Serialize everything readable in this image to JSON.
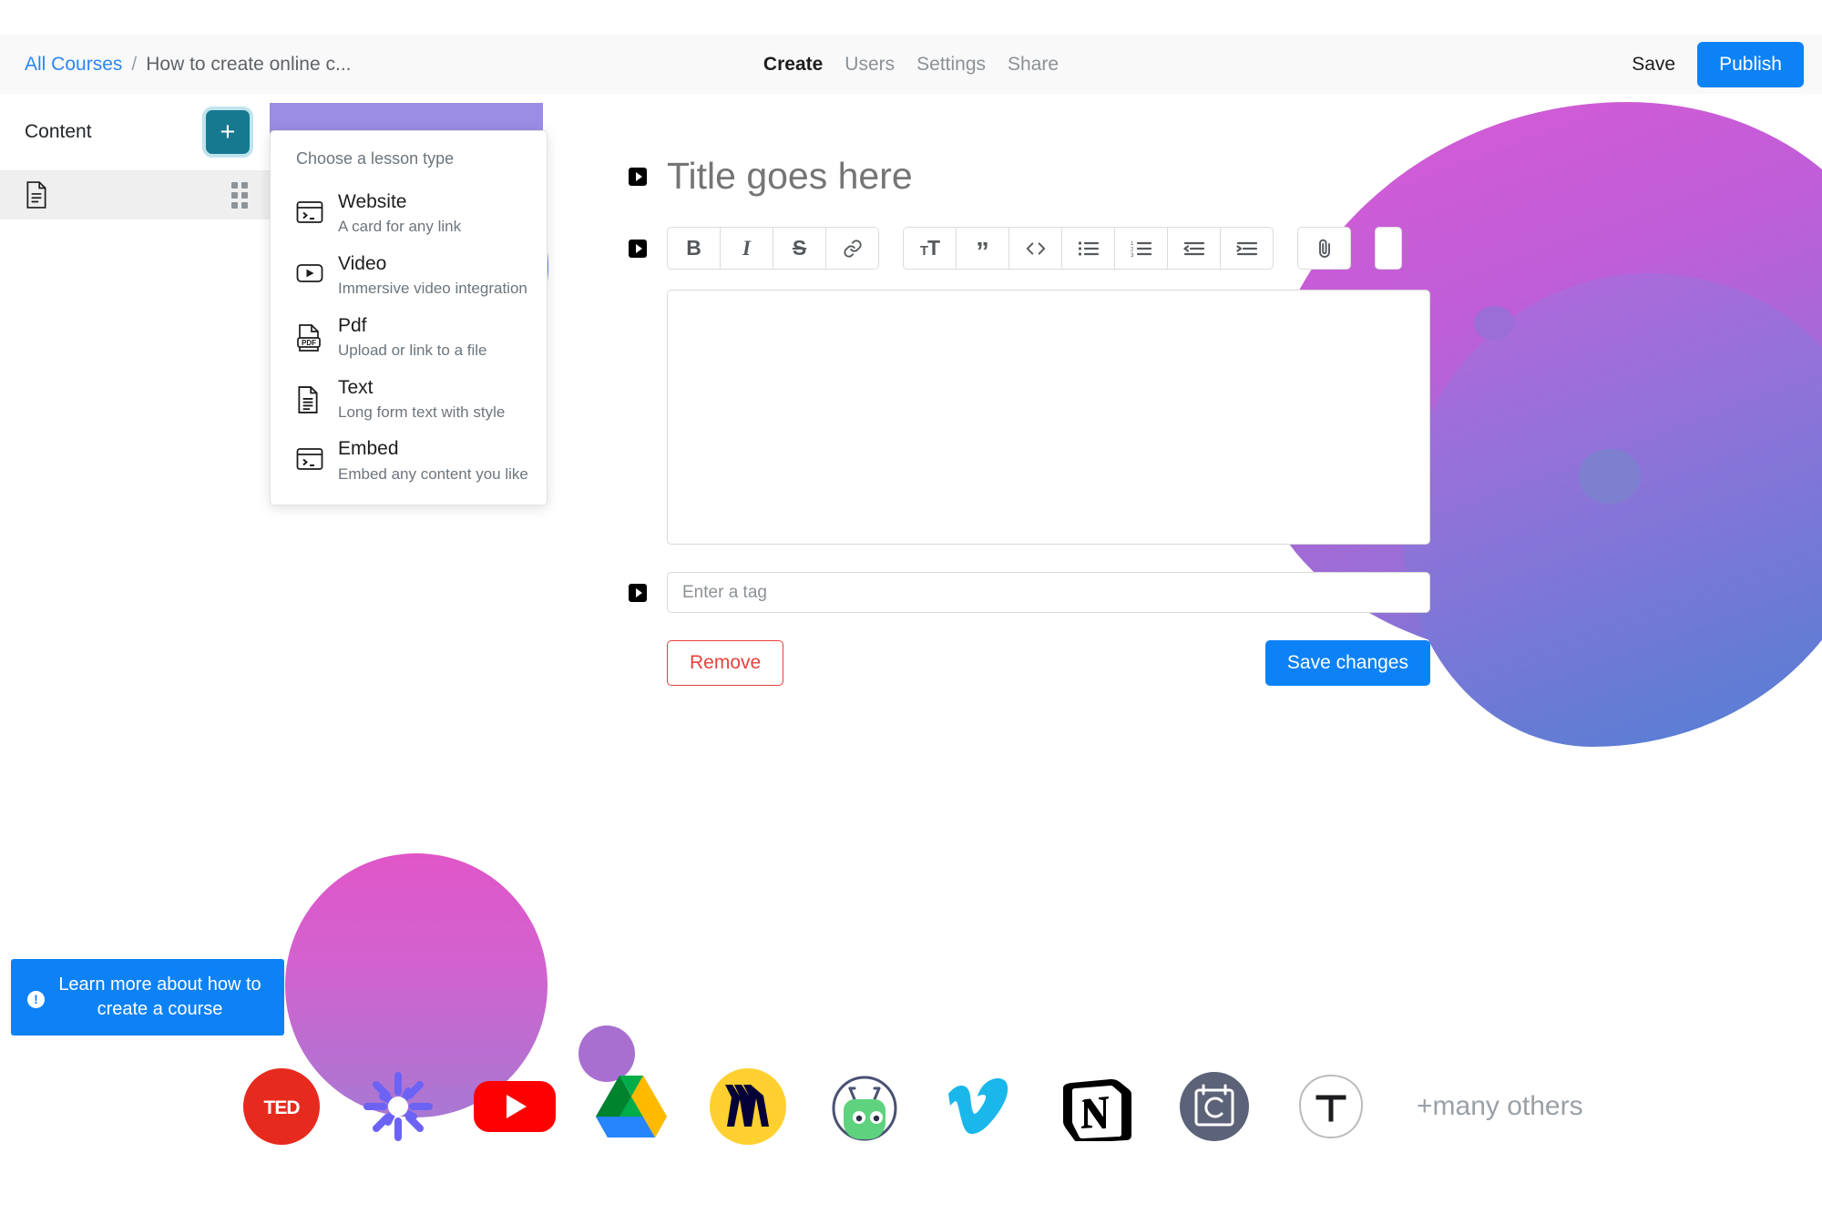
{
  "topbar": {
    "breadcrumb": {
      "root": "All Courses",
      "separator": "/",
      "current": "How to create online c..."
    },
    "nav": [
      {
        "label": "Create",
        "active": true
      },
      {
        "label": "Users",
        "active": false
      },
      {
        "label": "Settings",
        "active": false
      },
      {
        "label": "Share",
        "active": false
      }
    ],
    "save_label": "Save",
    "publish_label": "Publish"
  },
  "sidebar": {
    "title": "Content",
    "add_label": "+",
    "lesson_icon": "document-icon",
    "drag_handle": "drag-handle-icon"
  },
  "dropdown": {
    "title": "Choose a lesson type",
    "items": [
      {
        "label": "Website",
        "desc": "A card for any link",
        "icon": "terminal-window-icon"
      },
      {
        "label": "Video",
        "desc": "Immersive video integration",
        "icon": "video-play-icon"
      },
      {
        "label": "Pdf",
        "desc": "Upload or link to a file",
        "icon": "pdf-file-icon"
      },
      {
        "label": "Text",
        "desc": "Long form text with style",
        "icon": "text-document-icon"
      },
      {
        "label": "Embed",
        "desc": "Embed any content you like",
        "icon": "terminal-window-icon"
      }
    ]
  },
  "editor": {
    "title_value": "",
    "title_placeholder": "Title goes here",
    "body_value": "",
    "tag_placeholder": "Enter a tag",
    "tag_value": "",
    "remove_label": "Remove",
    "save_changes_label": "Save changes",
    "toolbar": [
      {
        "name": "bold-icon",
        "glyph": "B"
      },
      {
        "name": "italic-icon",
        "glyph": "I"
      },
      {
        "name": "strikethrough-icon",
        "glyph": "S"
      },
      {
        "name": "link-icon",
        "glyph": "link"
      },
      {
        "name": "text-size-icon",
        "glyph": "TT"
      },
      {
        "name": "blockquote-icon",
        "glyph": "”"
      },
      {
        "name": "code-icon",
        "glyph": "< >"
      },
      {
        "name": "bullet-list-icon",
        "glyph": "ul"
      },
      {
        "name": "numbered-list-icon",
        "glyph": "ol"
      },
      {
        "name": "outdent-icon",
        "glyph": "outdent"
      },
      {
        "name": "indent-icon",
        "glyph": "indent"
      },
      {
        "name": "attachment-icon",
        "glyph": "paperclip"
      }
    ]
  },
  "banner": {
    "text": "Learn more about how to create a course",
    "icon": "info-icon"
  },
  "logos": {
    "items": [
      {
        "name": "ted-logo",
        "label": "TED"
      },
      {
        "name": "retool-logo",
        "label": "Retool"
      },
      {
        "name": "youtube-logo",
        "label": "YouTube"
      },
      {
        "name": "google-drive-logo",
        "label": "Google Drive"
      },
      {
        "name": "miro-logo",
        "label": "Miro"
      },
      {
        "name": "codepen-robot-logo",
        "label": "CodeSandbox"
      },
      {
        "name": "vimeo-logo",
        "label": "Vimeo"
      },
      {
        "name": "notion-logo",
        "label": "Notion"
      },
      {
        "name": "calendar-logo",
        "label": "Calendly"
      },
      {
        "name": "typeform-logo",
        "label": "Typeform"
      }
    ],
    "more_label": "+many others"
  },
  "colors": {
    "accent_blue": "#0d82f7",
    "link_blue": "#2a87f5",
    "teal": "#17798f",
    "danger_red": "#e8413c",
    "blob_magenta": "#d95bd4",
    "blob_blue": "#4a7fd4"
  }
}
